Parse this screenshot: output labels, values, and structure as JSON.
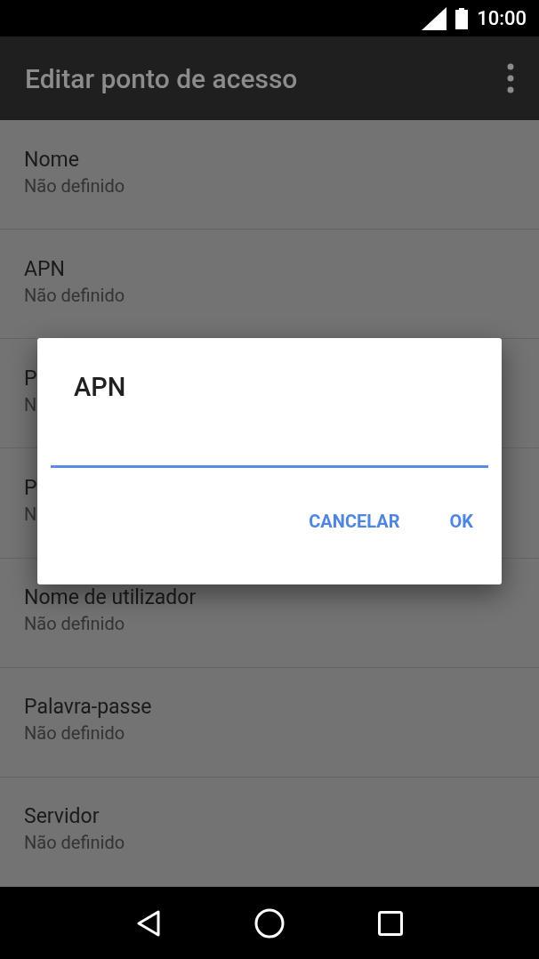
{
  "status_bar": {
    "time": "10:00"
  },
  "app_bar": {
    "title": "Editar ponto de acesso"
  },
  "settings": [
    {
      "title": "Nome",
      "summary": "Não definido"
    },
    {
      "title": "APN",
      "summary": "Não definido"
    },
    {
      "title": "P",
      "summary": "N"
    },
    {
      "title": "P",
      "summary": "N"
    },
    {
      "title": "Nome de utilizador",
      "summary": "Não definido"
    },
    {
      "title": "Palavra-passe",
      "summary": "Não definido"
    },
    {
      "title": "Servidor",
      "summary": "Não definido"
    }
  ],
  "dialog": {
    "title": "APN",
    "field": {
      "focused": true
    },
    "buttons": [
      "CANCELAR",
      "OK"
    ]
  }
}
